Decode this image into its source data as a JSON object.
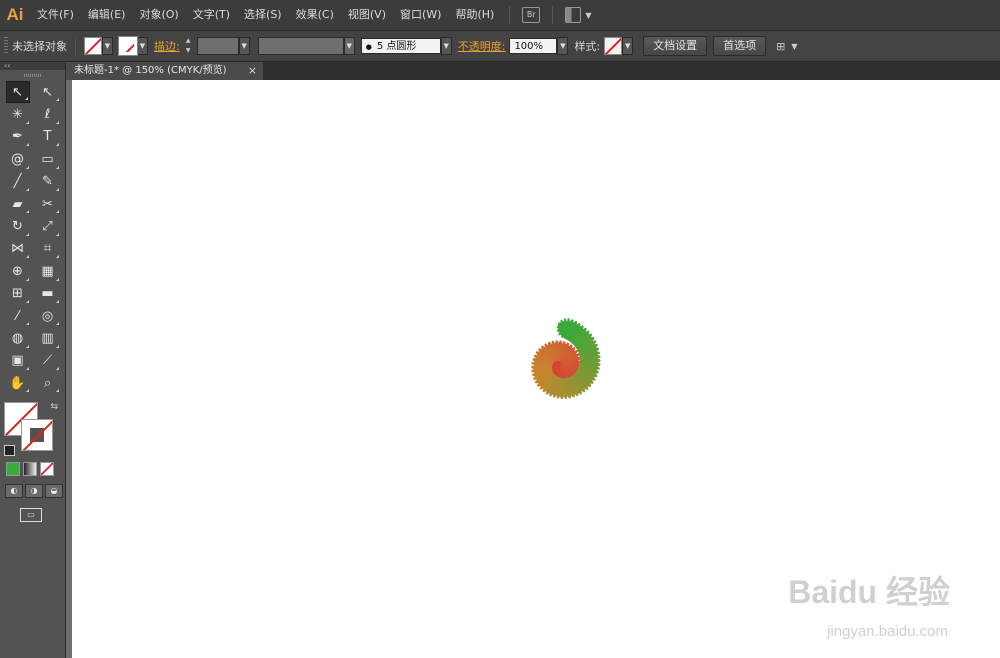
{
  "app": {
    "logo": "Ai"
  },
  "menu": {
    "items": [
      "文件(F)",
      "编辑(E)",
      "对象(O)",
      "文字(T)",
      "选择(S)",
      "效果(C)",
      "视图(V)",
      "窗口(W)",
      "帮助(H)"
    ],
    "bridge_icon": "Br"
  },
  "control": {
    "selection": "未选择对象",
    "stroke_label": "描边:",
    "brush_dot": "●",
    "brush_value": "5 点圆形",
    "opacity_label": "不透明度:",
    "opacity_value": "100%",
    "style_label": "样式:",
    "doc_setup": "文档设置",
    "preferences": "首选项"
  },
  "document": {
    "tab_title": "未标题-1* @ 150% (CMYK/预览)",
    "close": "×"
  },
  "tools": [
    {
      "name": "selection-tool",
      "glyph": "↖"
    },
    {
      "name": "direct-selection-tool",
      "glyph": "↖"
    },
    {
      "name": "magic-wand-tool",
      "glyph": "✳"
    },
    {
      "name": "lasso-tool",
      "glyph": "ℓ"
    },
    {
      "name": "pen-tool",
      "glyph": "✒"
    },
    {
      "name": "type-tool",
      "glyph": "T"
    },
    {
      "name": "spiral-tool",
      "glyph": "@"
    },
    {
      "name": "rectangle-tool",
      "glyph": "▭"
    },
    {
      "name": "paintbrush-tool",
      "glyph": "╱"
    },
    {
      "name": "pencil-tool",
      "glyph": "✎"
    },
    {
      "name": "blob-brush-tool",
      "glyph": "▰"
    },
    {
      "name": "scissors-tool",
      "glyph": "✂"
    },
    {
      "name": "rotate-tool",
      "glyph": "↻"
    },
    {
      "name": "scale-tool",
      "glyph": "⤢"
    },
    {
      "name": "width-tool",
      "glyph": "⋈"
    },
    {
      "name": "free-transform-tool",
      "glyph": "⌗"
    },
    {
      "name": "shape-builder-tool",
      "glyph": "⊕"
    },
    {
      "name": "perspective-grid-tool",
      "glyph": "▦"
    },
    {
      "name": "mesh-tool",
      "glyph": "⊞"
    },
    {
      "name": "gradient-tool",
      "glyph": "▬"
    },
    {
      "name": "eyedropper-tool",
      "glyph": "⁄"
    },
    {
      "name": "blend-tool",
      "glyph": "◎"
    },
    {
      "name": "symbol-sprayer-tool",
      "glyph": "◍"
    },
    {
      "name": "column-graph-tool",
      "glyph": "▥"
    },
    {
      "name": "artboard-tool",
      "glyph": "▣"
    },
    {
      "name": "slice-tool",
      "glyph": "⟋"
    },
    {
      "name": "hand-tool",
      "glyph": "✋"
    },
    {
      "name": "zoom-tool",
      "glyph": "⌕"
    }
  ],
  "fill_stroke": {
    "swap": "⇆"
  },
  "colors": {
    "chrome_dark": "#3c3c3c",
    "chrome": "#535353",
    "accent_orange": "#e8a033",
    "none_swatch_red": "#e02020",
    "spiral_inner": "#dc1e3c",
    "spiral_middle": "#c9862e",
    "spiral_outer": "#3aaa3a"
  },
  "watermark": {
    "main": "Baidu 经验",
    "sub": "jingyan.baidu.com"
  }
}
